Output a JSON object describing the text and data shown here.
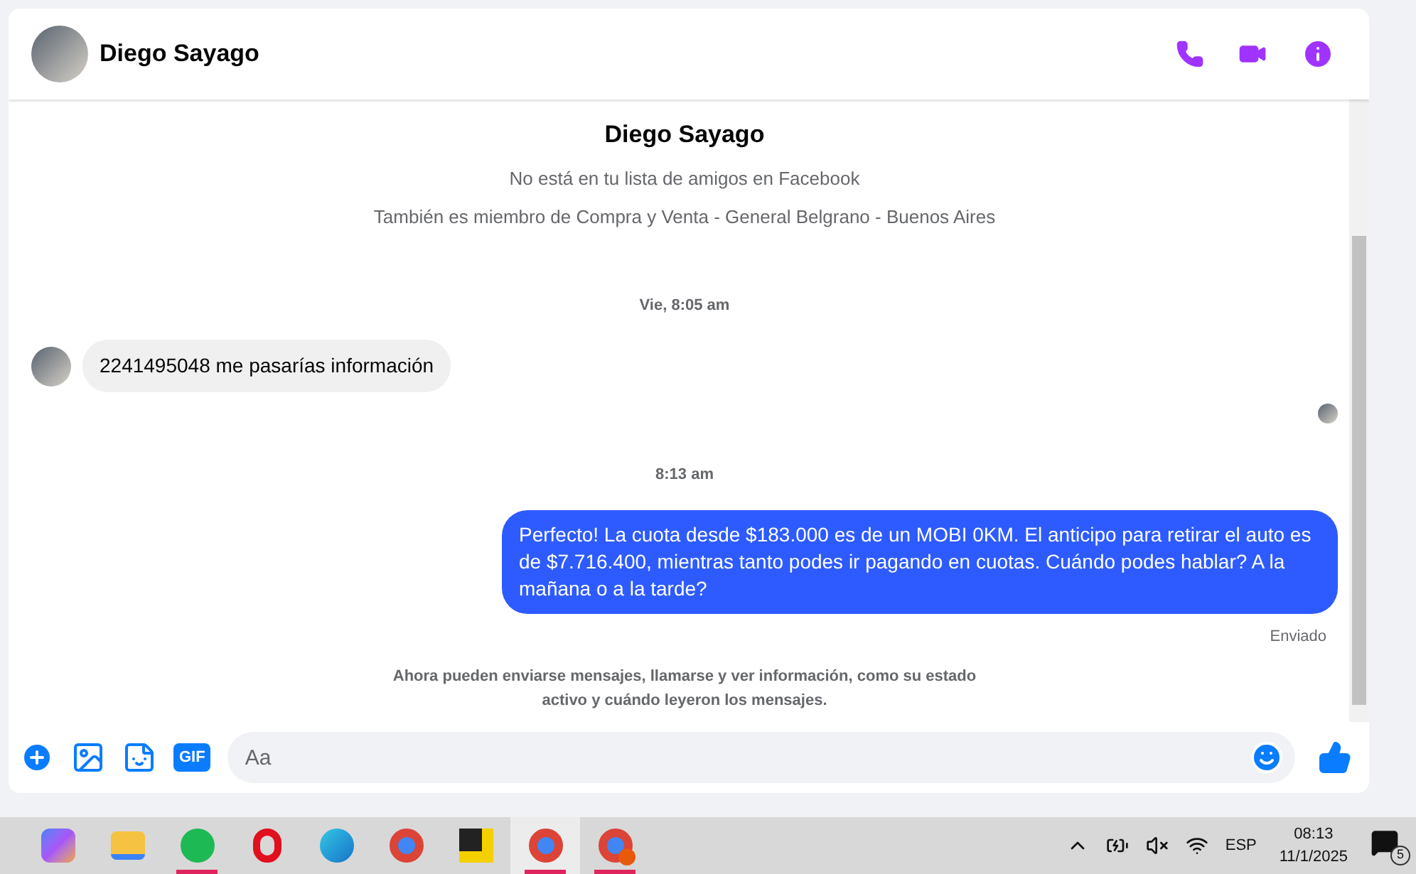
{
  "header": {
    "name": "Diego Sayago"
  },
  "profile": {
    "name": "Diego Sayago",
    "lines": [
      "No está en tu lista de amigos en Facebook",
      "También es miembro de Compra y Venta - General Belgrano - Buenos Aires"
    ]
  },
  "messages": [
    {
      "kind": "time",
      "text": "Vie, 8:05 am"
    },
    {
      "kind": "incoming",
      "text": "2241495048 me pasarías información"
    },
    {
      "kind": "seen"
    },
    {
      "kind": "time",
      "text": "8:13 am"
    },
    {
      "kind": "outgoing",
      "text": "Perfecto! La cuota desde $183.000 es de un MOBI 0KM. El anticipo para retirar el auto es de $7.716.400, mientras tanto podes ir pagando en cuotas. Cuándo podes hablar? A la mañana o a la tarde?"
    },
    {
      "kind": "status",
      "text": "Enviado"
    }
  ],
  "notice": "Ahora pueden enviarse mensajes, llamarse y ver información, como su estado activo y cuándo leyeron los mensajes.",
  "composer": {
    "gif_label": "GIF",
    "placeholder": "Aa"
  },
  "taskbar": {
    "apps": [
      {
        "kind": "copilot",
        "running": false,
        "selected": false
      },
      {
        "kind": "files",
        "running": false,
        "selected": false
      },
      {
        "kind": "spotify",
        "running": true,
        "selected": false
      },
      {
        "kind": "opera",
        "running": false,
        "selected": false
      },
      {
        "kind": "edge",
        "running": false,
        "selected": false
      },
      {
        "kind": "chrome",
        "running": false,
        "selected": false
      },
      {
        "kind": "notes",
        "running": false,
        "selected": false
      },
      {
        "kind": "chrome",
        "running": true,
        "selected": true
      },
      {
        "kind": "chrome-badge",
        "running": true,
        "selected": false
      }
    ],
    "language": "ESP",
    "time": "08:13",
    "date": "11/1/2025",
    "notifications": "5"
  }
}
